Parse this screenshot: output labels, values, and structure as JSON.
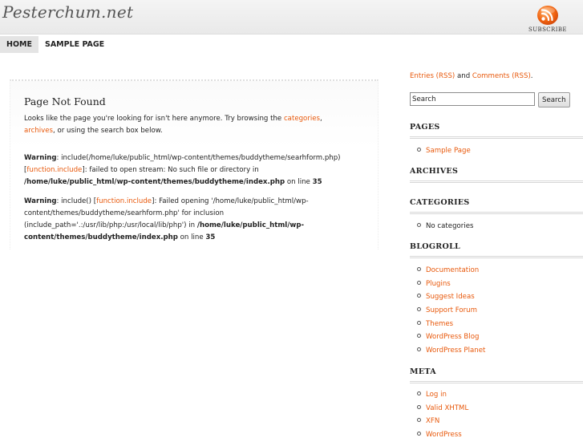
{
  "header": {
    "site_title": "Pesterchum.net",
    "subscribe_label": "SUBSCRIBE",
    "rss_icon": "rss-feed-icon"
  },
  "nav": {
    "items": [
      "HOME",
      "SAMPLE PAGE"
    ]
  },
  "main": {
    "title": "Page Not Found",
    "intro_before": "Looks like the page you're looking for isn't here anymore. Try browsing the ",
    "intro_link1": "categories",
    "intro_sep": ", ",
    "intro_link2": "archives",
    "intro_after": ", or using the search box below.",
    "warning1": {
      "label": "Warning",
      "text1": ": include(/home/luke/public_html/wp-content/themes/buddytheme/searhform.php) [",
      "link": "function.include",
      "text2": "]: failed to open stream: No such file or directory in ",
      "path": "/home/luke/public_html/wp-content/themes/buddytheme/index.php",
      "text3": " on line ",
      "line": "35"
    },
    "warning2": {
      "label": "Warning",
      "text1": ": include() [",
      "link": "function.include",
      "text2": "]: Failed opening '/home/luke/public_html/wp-content/themes/buddytheme/searhform.php' for inclusion (include_path='.:/usr/lib/php:/usr/local/lib/php') in ",
      "path": "/home/luke/public_html/wp-content/themes/buddytheme/index.php",
      "text3": " on line ",
      "line": "35"
    }
  },
  "sidebar": {
    "feeds": {
      "entries": "Entries (RSS)",
      "and": " and ",
      "comments": "Comments (RSS)",
      "end": "."
    },
    "search": {
      "value": "Search",
      "button": "Search"
    },
    "pages": {
      "title": "PAGES",
      "items": [
        "Sample Page"
      ]
    },
    "archives": {
      "title": "ARCHIVES"
    },
    "categories": {
      "title": "CATEGORIES",
      "items": [
        "No categories"
      ]
    },
    "blogroll": {
      "title": "BLOGROLL",
      "items": [
        "Documentation",
        "Plugins",
        "Suggest Ideas",
        "Support Forum",
        "Themes",
        "WordPress Blog",
        "WordPress Planet"
      ]
    },
    "meta": {
      "title": "META",
      "items": [
        "Log in",
        "Valid XHTML",
        "XFN",
        "WordPress"
      ]
    }
  },
  "colors": {
    "link": "#e8590c",
    "header_bg": "#ececec"
  }
}
